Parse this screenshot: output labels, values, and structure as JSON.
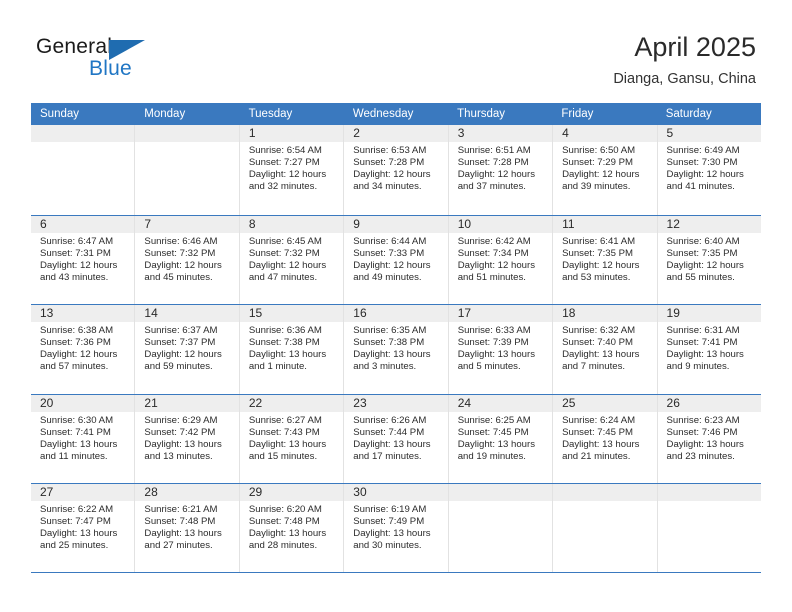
{
  "brand": {
    "name_part1": "General",
    "name_part2": "Blue",
    "triangle_color": "#1f6cb0",
    "blue_color": "#2076c4"
  },
  "header": {
    "title": "April 2025",
    "location": "Dianga, Gansu, China"
  },
  "colors": {
    "header_blue": "#3a79bf",
    "day_band_gray": "#eeeeee",
    "cell_border": "#e2e2e2"
  },
  "weekdays": [
    "Sunday",
    "Monday",
    "Tuesday",
    "Wednesday",
    "Thursday",
    "Friday",
    "Saturday"
  ],
  "weeks": [
    [
      {
        "day": "",
        "sunrise": "",
        "sunset": "",
        "daylight1": "",
        "daylight2": ""
      },
      {
        "day": "",
        "sunrise": "",
        "sunset": "",
        "daylight1": "",
        "daylight2": ""
      },
      {
        "day": "1",
        "sunrise": "Sunrise: 6:54 AM",
        "sunset": "Sunset: 7:27 PM",
        "daylight1": "Daylight: 12 hours",
        "daylight2": "and 32 minutes."
      },
      {
        "day": "2",
        "sunrise": "Sunrise: 6:53 AM",
        "sunset": "Sunset: 7:28 PM",
        "daylight1": "Daylight: 12 hours",
        "daylight2": "and 34 minutes."
      },
      {
        "day": "3",
        "sunrise": "Sunrise: 6:51 AM",
        "sunset": "Sunset: 7:28 PM",
        "daylight1": "Daylight: 12 hours",
        "daylight2": "and 37 minutes."
      },
      {
        "day": "4",
        "sunrise": "Sunrise: 6:50 AM",
        "sunset": "Sunset: 7:29 PM",
        "daylight1": "Daylight: 12 hours",
        "daylight2": "and 39 minutes."
      },
      {
        "day": "5",
        "sunrise": "Sunrise: 6:49 AM",
        "sunset": "Sunset: 7:30 PM",
        "daylight1": "Daylight: 12 hours",
        "daylight2": "and 41 minutes."
      }
    ],
    [
      {
        "day": "6",
        "sunrise": "Sunrise: 6:47 AM",
        "sunset": "Sunset: 7:31 PM",
        "daylight1": "Daylight: 12 hours",
        "daylight2": "and 43 minutes."
      },
      {
        "day": "7",
        "sunrise": "Sunrise: 6:46 AM",
        "sunset": "Sunset: 7:32 PM",
        "daylight1": "Daylight: 12 hours",
        "daylight2": "and 45 minutes."
      },
      {
        "day": "8",
        "sunrise": "Sunrise: 6:45 AM",
        "sunset": "Sunset: 7:32 PM",
        "daylight1": "Daylight: 12 hours",
        "daylight2": "and 47 minutes."
      },
      {
        "day": "9",
        "sunrise": "Sunrise: 6:44 AM",
        "sunset": "Sunset: 7:33 PM",
        "daylight1": "Daylight: 12 hours",
        "daylight2": "and 49 minutes."
      },
      {
        "day": "10",
        "sunrise": "Sunrise: 6:42 AM",
        "sunset": "Sunset: 7:34 PM",
        "daylight1": "Daylight: 12 hours",
        "daylight2": "and 51 minutes."
      },
      {
        "day": "11",
        "sunrise": "Sunrise: 6:41 AM",
        "sunset": "Sunset: 7:35 PM",
        "daylight1": "Daylight: 12 hours",
        "daylight2": "and 53 minutes."
      },
      {
        "day": "12",
        "sunrise": "Sunrise: 6:40 AM",
        "sunset": "Sunset: 7:35 PM",
        "daylight1": "Daylight: 12 hours",
        "daylight2": "and 55 minutes."
      }
    ],
    [
      {
        "day": "13",
        "sunrise": "Sunrise: 6:38 AM",
        "sunset": "Sunset: 7:36 PM",
        "daylight1": "Daylight: 12 hours",
        "daylight2": "and 57 minutes."
      },
      {
        "day": "14",
        "sunrise": "Sunrise: 6:37 AM",
        "sunset": "Sunset: 7:37 PM",
        "daylight1": "Daylight: 12 hours",
        "daylight2": "and 59 minutes."
      },
      {
        "day": "15",
        "sunrise": "Sunrise: 6:36 AM",
        "sunset": "Sunset: 7:38 PM",
        "daylight1": "Daylight: 13 hours",
        "daylight2": "and 1 minute."
      },
      {
        "day": "16",
        "sunrise": "Sunrise: 6:35 AM",
        "sunset": "Sunset: 7:38 PM",
        "daylight1": "Daylight: 13 hours",
        "daylight2": "and 3 minutes."
      },
      {
        "day": "17",
        "sunrise": "Sunrise: 6:33 AM",
        "sunset": "Sunset: 7:39 PM",
        "daylight1": "Daylight: 13 hours",
        "daylight2": "and 5 minutes."
      },
      {
        "day": "18",
        "sunrise": "Sunrise: 6:32 AM",
        "sunset": "Sunset: 7:40 PM",
        "daylight1": "Daylight: 13 hours",
        "daylight2": "and 7 minutes."
      },
      {
        "day": "19",
        "sunrise": "Sunrise: 6:31 AM",
        "sunset": "Sunset: 7:41 PM",
        "daylight1": "Daylight: 13 hours",
        "daylight2": "and 9 minutes."
      }
    ],
    [
      {
        "day": "20",
        "sunrise": "Sunrise: 6:30 AM",
        "sunset": "Sunset: 7:41 PM",
        "daylight1": "Daylight: 13 hours",
        "daylight2": "and 11 minutes."
      },
      {
        "day": "21",
        "sunrise": "Sunrise: 6:29 AM",
        "sunset": "Sunset: 7:42 PM",
        "daylight1": "Daylight: 13 hours",
        "daylight2": "and 13 minutes."
      },
      {
        "day": "22",
        "sunrise": "Sunrise: 6:27 AM",
        "sunset": "Sunset: 7:43 PM",
        "daylight1": "Daylight: 13 hours",
        "daylight2": "and 15 minutes."
      },
      {
        "day": "23",
        "sunrise": "Sunrise: 6:26 AM",
        "sunset": "Sunset: 7:44 PM",
        "daylight1": "Daylight: 13 hours",
        "daylight2": "and 17 minutes."
      },
      {
        "day": "24",
        "sunrise": "Sunrise: 6:25 AM",
        "sunset": "Sunset: 7:45 PM",
        "daylight1": "Daylight: 13 hours",
        "daylight2": "and 19 minutes."
      },
      {
        "day": "25",
        "sunrise": "Sunrise: 6:24 AM",
        "sunset": "Sunset: 7:45 PM",
        "daylight1": "Daylight: 13 hours",
        "daylight2": "and 21 minutes."
      },
      {
        "day": "26",
        "sunrise": "Sunrise: 6:23 AM",
        "sunset": "Sunset: 7:46 PM",
        "daylight1": "Daylight: 13 hours",
        "daylight2": "and 23 minutes."
      }
    ],
    [
      {
        "day": "27",
        "sunrise": "Sunrise: 6:22 AM",
        "sunset": "Sunset: 7:47 PM",
        "daylight1": "Daylight: 13 hours",
        "daylight2": "and 25 minutes."
      },
      {
        "day": "28",
        "sunrise": "Sunrise: 6:21 AM",
        "sunset": "Sunset: 7:48 PM",
        "daylight1": "Daylight: 13 hours",
        "daylight2": "and 27 minutes."
      },
      {
        "day": "29",
        "sunrise": "Sunrise: 6:20 AM",
        "sunset": "Sunset: 7:48 PM",
        "daylight1": "Daylight: 13 hours",
        "daylight2": "and 28 minutes."
      },
      {
        "day": "30",
        "sunrise": "Sunrise: 6:19 AM",
        "sunset": "Sunset: 7:49 PM",
        "daylight1": "Daylight: 13 hours",
        "daylight2": "and 30 minutes."
      },
      {
        "day": "",
        "sunrise": "",
        "sunset": "",
        "daylight1": "",
        "daylight2": ""
      },
      {
        "day": "",
        "sunrise": "",
        "sunset": "",
        "daylight1": "",
        "daylight2": ""
      },
      {
        "day": "",
        "sunrise": "",
        "sunset": "",
        "daylight1": "",
        "daylight2": ""
      }
    ]
  ]
}
